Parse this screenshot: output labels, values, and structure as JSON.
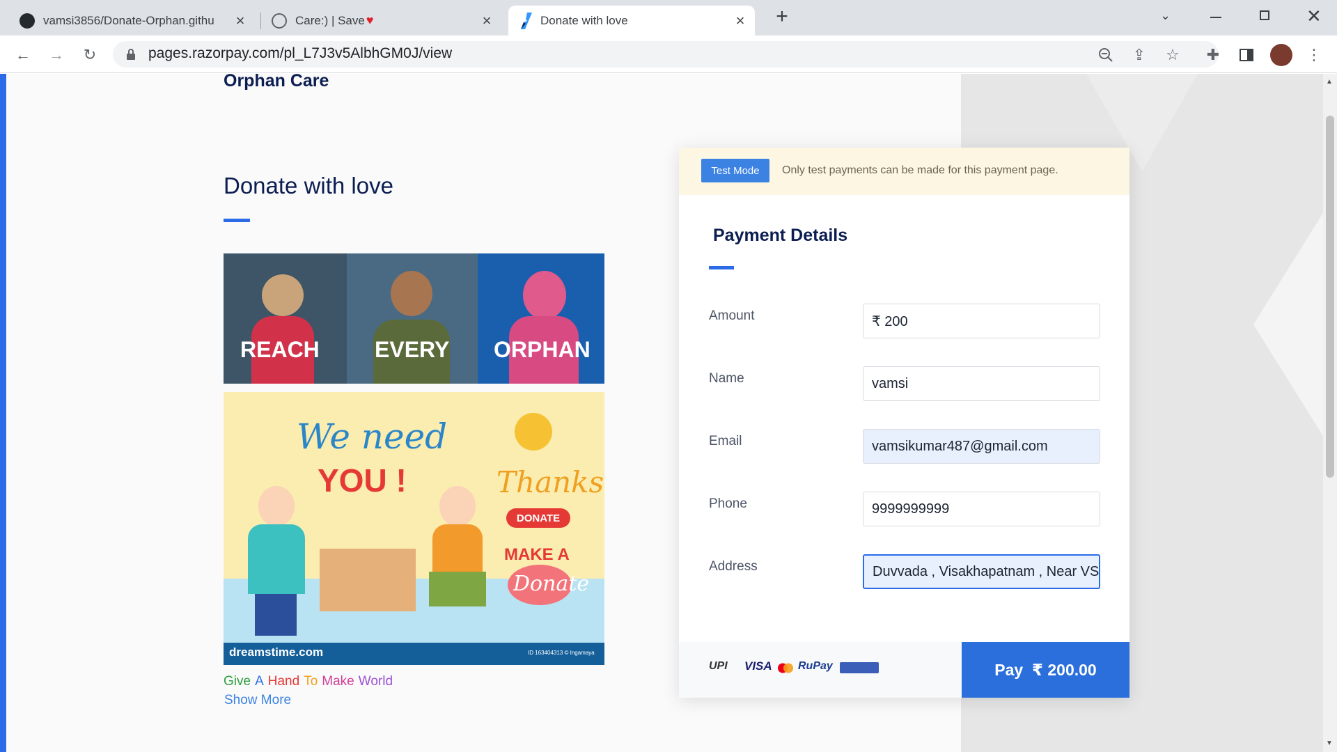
{
  "browser": {
    "tabs": [
      {
        "title": "vamsi3856/Donate-Orphan.githu",
        "icon": "github-icon"
      },
      {
        "title": "Care:) | Save",
        "icon": "globe-icon",
        "suffix_icon": "heart-icon"
      },
      {
        "title": "Donate with love",
        "icon": "razorpay-icon"
      }
    ],
    "new_tab": "+",
    "url": "pages.razorpay.com/pl_L7J3v5AlbhGM0J/view"
  },
  "page": {
    "brand": "Orphan Care",
    "heading": "Donate with love",
    "banner_words": [
      "REACH",
      "EVERY",
      "ORPHAN"
    ],
    "poster": {
      "we_need": "We need",
      "you": "YOU !",
      "thanks": "Thanks!",
      "donate_pill": "DONATE",
      "make_a": "MAKE A",
      "donate_script": "Donate",
      "footer_brand": "dreamstime.com",
      "footer_id": "ID 163404313 © Ingamaya"
    },
    "tagline_words": [
      "Give",
      "A",
      "Hand",
      "To",
      "Make",
      "World"
    ],
    "tagline_colors": [
      "#2e9e3e",
      "#2b6be8",
      "#e53935",
      "#f0a020",
      "#d0409a",
      "#9c4fd6"
    ],
    "show_more": "Show More"
  },
  "payment": {
    "test_badge": "Test Mode",
    "test_note": "Only test payments can be made for this payment page.",
    "title": "Payment Details",
    "fields": [
      {
        "label": "Amount",
        "value": "₹ 200"
      },
      {
        "label": "Name",
        "value": "vamsi"
      },
      {
        "label": "Email",
        "value": "vamsikumar487@gmail.com"
      },
      {
        "label": "Phone",
        "value": "9999999999"
      },
      {
        "label": "Address",
        "value": "Duvvada , Visakhapatnam , Near VS"
      }
    ],
    "methods": [
      "UPI",
      "VISA",
      "RuPay"
    ],
    "pay_button": "Pay  ₹ 200.00"
  },
  "colors": {
    "accent": "#2b6be8",
    "heading": "#0b1d51"
  }
}
